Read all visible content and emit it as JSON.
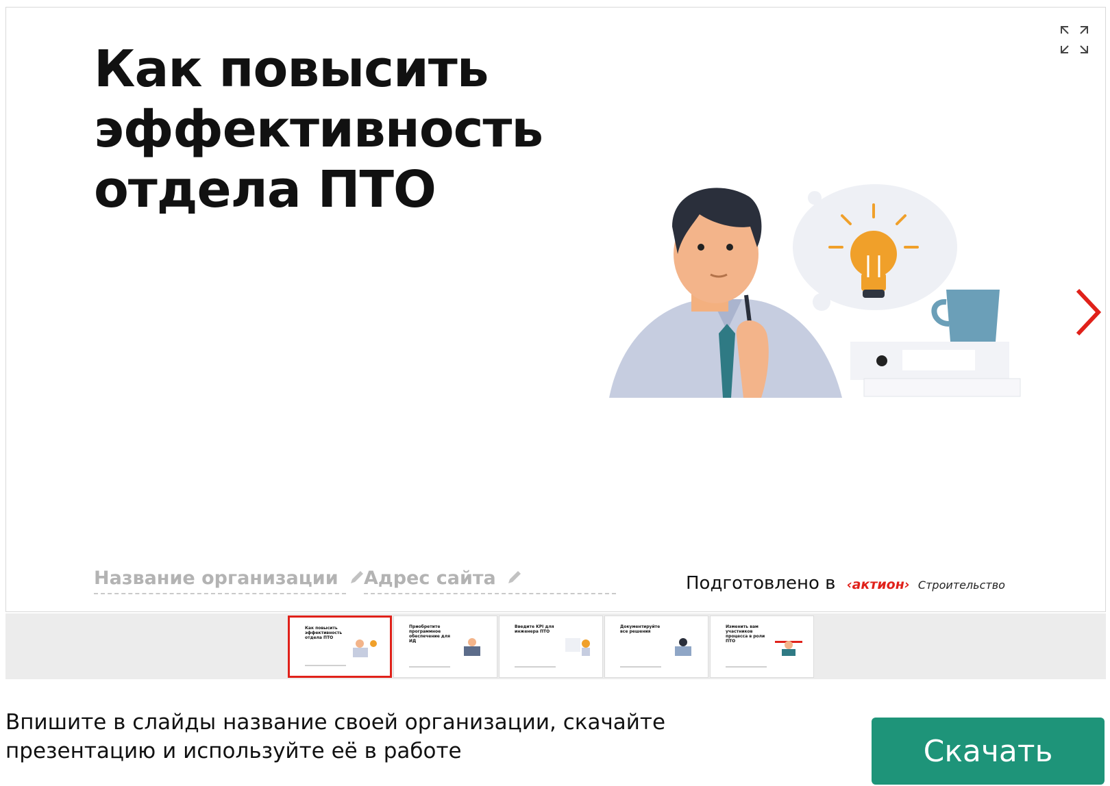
{
  "slide": {
    "title_lines": [
      "Как повысить",
      "эффективность",
      "отдела ПТО"
    ],
    "org_placeholder": "Название организации",
    "site_placeholder": "Адрес сайта",
    "prepared_text": "Подготовлено в",
    "brand_name": "‹актион›",
    "brand_sub": "Строительство"
  },
  "thumbnails": [
    {
      "text": "Как повысить эффективность отдела ПТО",
      "active": true
    },
    {
      "text": "Приобретите программное обеспечение для ИД",
      "active": false
    },
    {
      "text": "Введите KPI для инженера ПТО",
      "active": false
    },
    {
      "text": "Документируйте все решения",
      "active": false
    },
    {
      "text": "Изменить вам участников процесса в роли ПТО",
      "active": false
    }
  ],
  "footer": {
    "hint_lines": [
      "Впишите в слайды название своей организации, скачайте",
      "презентацию и используйте её в работе"
    ],
    "download_label": "Скачать"
  },
  "colors": {
    "accent": "#e0211a",
    "button": "#1e9479"
  },
  "icons": {
    "expand": "expand-icon",
    "next": "chevron-right-icon",
    "edit": "pencil-icon"
  }
}
